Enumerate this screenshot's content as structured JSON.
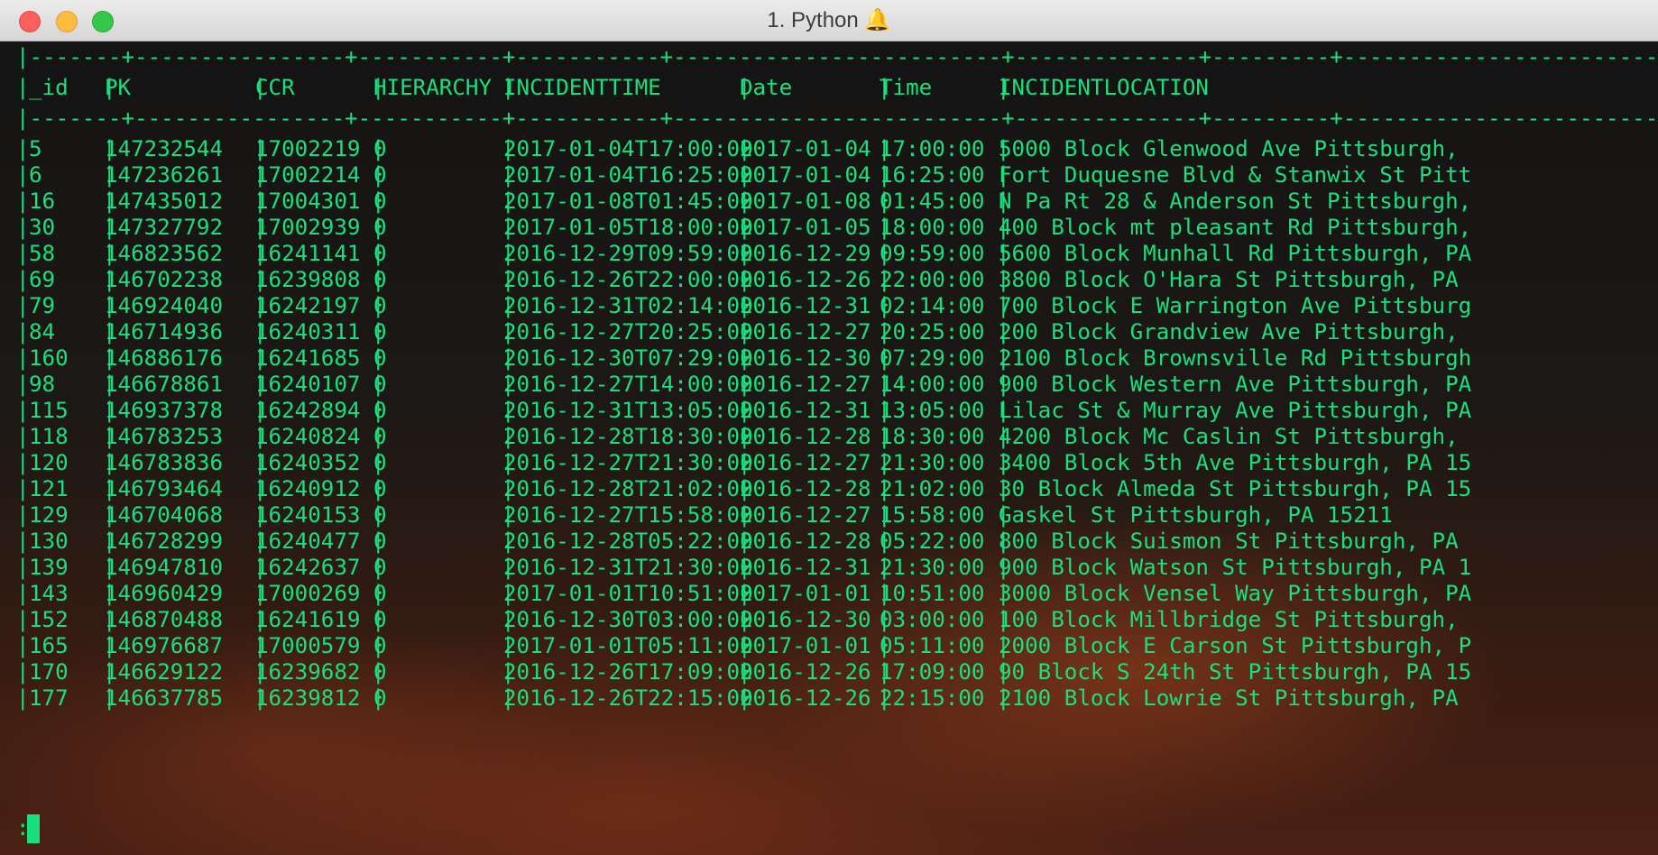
{
  "window": {
    "title": "1. Python",
    "title_icon": "bell-icon"
  },
  "terminal": {
    "text_color": "#19e07e",
    "border_line": "|-------+----------------+-----------+-----------+-------------------------+--------------+---------+--------------------------------------------------",
    "columns": [
      "_id",
      "PK",
      "CCR",
      "HIERARCHY",
      "INCIDENTTIME",
      "Date",
      "Time",
      "INCIDENTLOCATION"
    ],
    "rows": [
      [
        "5",
        "147232544",
        "17002219",
        "0",
        "2017-01-04T17:00:00",
        "2017-01-04",
        "17:00:00",
        "5000 Block Glenwood Ave Pittsburgh,"
      ],
      [
        "6",
        "147236261",
        "17002214",
        "0",
        "2017-01-04T16:25:00",
        "2017-01-04",
        "16:25:00",
        "Fort Duquesne Blvd & Stanwix St Pitt"
      ],
      [
        "16",
        "147435012",
        "17004301",
        "0",
        "2017-01-08T01:45:00",
        "2017-01-08",
        "01:45:00",
        "N Pa Rt 28 & Anderson St Pittsburgh,"
      ],
      [
        "30",
        "147327792",
        "17002939",
        "0",
        "2017-01-05T18:00:00",
        "2017-01-05",
        "18:00:00",
        "400 Block mt pleasant Rd Pittsburgh,"
      ],
      [
        "58",
        "146823562",
        "16241141",
        "0",
        "2016-12-29T09:59:00",
        "2016-12-29",
        "09:59:00",
        "5600 Block Munhall Rd Pittsburgh, PA"
      ],
      [
        "69",
        "146702238",
        "16239808",
        "0",
        "2016-12-26T22:00:00",
        "2016-12-26",
        "22:00:00",
        "3800 Block O'Hara St Pittsburgh, PA"
      ],
      [
        "79",
        "146924040",
        "16242197",
        "0",
        "2016-12-31T02:14:00",
        "2016-12-31",
        "02:14:00",
        "700 Block E Warrington Ave Pittsburg"
      ],
      [
        "84",
        "146714936",
        "16240311",
        "0",
        "2016-12-27T20:25:00",
        "2016-12-27",
        "20:25:00",
        "200 Block Grandview Ave Pittsburgh,"
      ],
      [
        "160",
        "146886176",
        "16241685",
        "0",
        "2016-12-30T07:29:00",
        "2016-12-30",
        "07:29:00",
        "2100 Block Brownsville Rd Pittsburgh"
      ],
      [
        "98",
        "146678861",
        "16240107",
        "0",
        "2016-12-27T14:00:00",
        "2016-12-27",
        "14:00:00",
        "900 Block Western Ave Pittsburgh, PA"
      ],
      [
        "115",
        "146937378",
        "16242894",
        "0",
        "2016-12-31T13:05:00",
        "2016-12-31",
        "13:05:00",
        "Lilac St & Murray Ave Pittsburgh, PA"
      ],
      [
        "118",
        "146783253",
        "16240824",
        "0",
        "2016-12-28T18:30:00",
        "2016-12-28",
        "18:30:00",
        "4200 Block Mc Caslin St Pittsburgh,"
      ],
      [
        "120",
        "146783836",
        "16240352",
        "0",
        "2016-12-27T21:30:00",
        "2016-12-27",
        "21:30:00",
        "3400 Block 5th Ave Pittsburgh, PA 15"
      ],
      [
        "121",
        "146793464",
        "16240912",
        "0",
        "2016-12-28T21:02:00",
        "2016-12-28",
        "21:02:00",
        "30 Block Almeda St Pittsburgh, PA 15"
      ],
      [
        "129",
        "146704068",
        "16240153",
        "0",
        "2016-12-27T15:58:00",
        "2016-12-27",
        "15:58:00",
        "Gaskel St Pittsburgh, PA 15211"
      ],
      [
        "130",
        "146728299",
        "16240477",
        "0",
        "2016-12-28T05:22:00",
        "2016-12-28",
        "05:22:00",
        "800 Block Suismon St Pittsburgh, PA"
      ],
      [
        "139",
        "146947810",
        "16242637",
        "0",
        "2016-12-31T21:30:00",
        "2016-12-31",
        "21:30:00",
        "900 Block Watson St Pittsburgh, PA 1"
      ],
      [
        "143",
        "146960429",
        "17000269",
        "0",
        "2017-01-01T10:51:00",
        "2017-01-01",
        "10:51:00",
        "3000 Block Vensel Way Pittsburgh, PA"
      ],
      [
        "152",
        "146870488",
        "16241619",
        "0",
        "2016-12-30T03:00:00",
        "2016-12-30",
        "03:00:00",
        "100 Block Millbridge St Pittsburgh,"
      ],
      [
        "165",
        "146976687",
        "17000579",
        "0",
        "2017-01-01T05:11:00",
        "2017-01-01",
        "05:11:00",
        "2000 Block E Carson St Pittsburgh, P"
      ],
      [
        "170",
        "146629122",
        "16239682",
        "0",
        "2016-12-26T17:09:00",
        "2016-12-26",
        "17:09:00",
        "90 Block S 24th St Pittsburgh, PA 15"
      ],
      [
        "177",
        "146637785",
        "16239812",
        "0",
        "2016-12-26T22:15:00",
        "2016-12-26",
        "22:15:00",
        "2100 Block Lowrie St Pittsburgh, PA"
      ]
    ],
    "prompt": ":"
  }
}
